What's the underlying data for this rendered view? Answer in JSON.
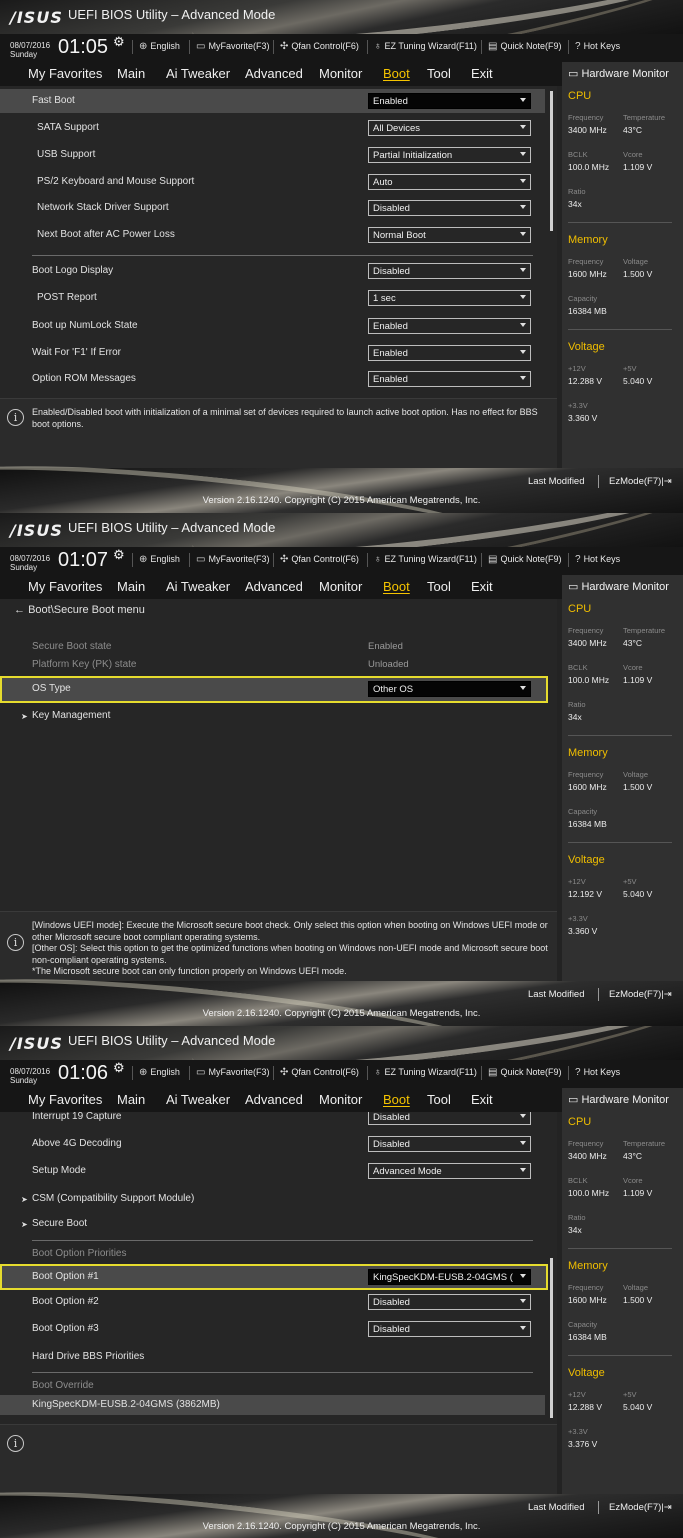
{
  "app": {
    "logo": "/ISUS",
    "title": "UEFI BIOS Utility – Advanced Mode"
  },
  "toolbar": {
    "language": "English",
    "myfavorite": "MyFavorite(F3)",
    "qfan": "Qfan Control(F6)",
    "ez_tuning": "EZ Tuning Wizard(F11)",
    "quick_note": "Quick Note(F9)",
    "hot_keys": "Hot Keys"
  },
  "menu": [
    "My Favorites",
    "Main",
    "Ai Tweaker",
    "Advanced",
    "Monitor",
    "Boot",
    "Tool",
    "Exit"
  ],
  "active_menu": "Boot",
  "hardware_monitor": {
    "title": "Hardware Monitor",
    "cpu": {
      "label": "CPU",
      "frequency_label": "Frequency",
      "temperature_label": "Temperature",
      "bclk_label": "BCLK",
      "vcore_label": "Vcore",
      "ratio_label": "Ratio",
      "frequency": "3400 MHz",
      "temperature": "43°C",
      "bclk": "100.0 MHz",
      "vcore": "1.109 V",
      "ratio": "34x"
    },
    "memory": {
      "label": "Memory",
      "frequency_label": "Frequency",
      "voltage_label": "Voltage",
      "capacity_label": "Capacity",
      "frequency": "1600 MHz",
      "voltage": "1.500 V",
      "capacity": "16384 MB"
    },
    "voltage": {
      "label": "Voltage",
      "v12_label": "+12V",
      "v5_label": "+5V",
      "v33_label": "+3.3V"
    }
  },
  "footer": {
    "last_modified": "Last Modified",
    "ezmode": "EzMode(F7)|⇥",
    "version": "Version 2.16.1240. Copyright (C) 2015 American Megatrends, Inc."
  },
  "screens": [
    {
      "date": "08/07/2016",
      "day": "Sunday",
      "time": "01:05",
      "voltages": {
        "v12": "12.288 V",
        "v5": "5.040 V",
        "v33": "3.360 V"
      },
      "settings": [
        {
          "label": "Fast Boot",
          "value": "Enabled"
        },
        {
          "label": "SATA Support",
          "value": "All Devices"
        },
        {
          "label": "USB Support",
          "value": "Partial Initialization"
        },
        {
          "label": "PS/2 Keyboard and Mouse Support",
          "value": "Auto"
        },
        {
          "label": "Network Stack Driver Support",
          "value": "Disabled"
        },
        {
          "label": "Next Boot after AC Power Loss",
          "value": "Normal Boot"
        },
        {
          "label": "Boot Logo Display",
          "value": "Disabled"
        },
        {
          "label": "POST Report",
          "value": "1 sec"
        },
        {
          "label": "Boot up NumLock State",
          "value": "Enabled"
        },
        {
          "label": "Wait For 'F1' If Error",
          "value": "Enabled"
        },
        {
          "label": "Option ROM Messages",
          "value": "Enabled"
        }
      ],
      "help": "Enabled/Disabled boot with initialization of a minimal set of devices required to launch active boot option. Has no effect for BBS boot options."
    },
    {
      "date": "08/07/2016",
      "day": "Sunday",
      "time": "01:07",
      "voltages": {
        "v12": "12.192 V",
        "v5": "5.040 V",
        "v33": "3.360 V"
      },
      "breadcrumb": "Boot\\Secure Boot menu",
      "secure_boot_state_label": "Secure Boot state",
      "secure_boot_state": "Enabled",
      "pk_state_label": "Platform Key (PK) state",
      "pk_state": "Unloaded",
      "os_type_label": "OS Type",
      "os_type": "Other OS",
      "key_management": "Key Management",
      "help": [
        "[Windows UEFI mode]: Execute the Microsoft secure boot check. Only select this option when booting on Windows UEFI mode or other Microsoft secure boot compliant operating systems.",
        "[Other OS]: Select this option to get the optimized functions when booting on Windows non-UEFI mode and Microsoft secure boot non-compliant operating systems.",
        "*The Microsoft secure boot can only function properly on Windows UEFI mode."
      ]
    },
    {
      "date": "08/07/2016",
      "day": "Sunday",
      "time": "01:06",
      "voltages": {
        "v12": "12.288 V",
        "v5": "5.040 V",
        "v33": "3.376 V"
      },
      "interrupt19_label": "Interrupt 19 Capture",
      "interrupt19": "Disabled",
      "above4g_label": "Above 4G Decoding",
      "above4g": "Disabled",
      "setup_mode_label": "Setup Mode",
      "setup_mode": "Advanced Mode",
      "csm": "CSM (Compatibility Support Module)",
      "secure_boot": "Secure Boot",
      "priorities_heading": "Boot Option Priorities",
      "boot1_label": "Boot Option #1",
      "boot1": "KingSpecKDM-EUSB.2-04GMS (3",
      "boot2_label": "Boot Option #2",
      "boot2": "Disabled",
      "boot3_label": "Boot Option #3",
      "boot3": "Disabled",
      "hdd_bbs": "Hard Drive BBS Priorities",
      "override_heading": "Boot Override",
      "override_item": "KingSpecKDM-EUSB.2-04GMS  (3862MB)"
    }
  ]
}
